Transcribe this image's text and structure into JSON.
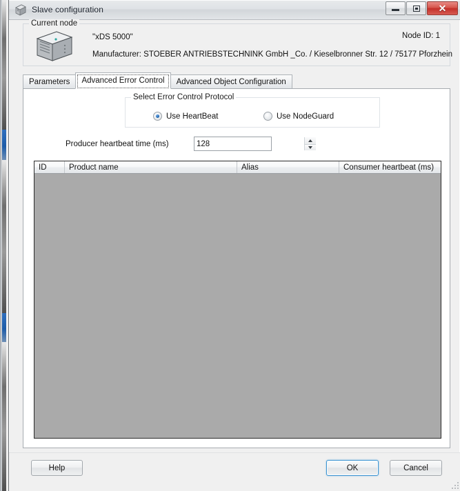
{
  "window": {
    "title": "Slave configuration",
    "icon": "device-box-icon",
    "controls": {
      "minimize_label": "Minimize",
      "restore_label": "Restore",
      "close_label": "Close",
      "close_glyph": "✕"
    }
  },
  "current_node": {
    "group_title": "Current node",
    "icon": "network-device-icon",
    "node_name": "\"xDS 5000\"",
    "node_id": "Node ID: 1",
    "manufacturer": "Manufacturer: STOEBER ANTRIEBSTECHNINK GmbH _Co. / Kieselbronner Str. 12 / 75177 Pforzhein"
  },
  "tabs": [
    {
      "label": "Parameters",
      "selected": false
    },
    {
      "label": "Advanced Error Control",
      "selected": true
    },
    {
      "label": "Advanced Object Configuration",
      "selected": false
    }
  ],
  "error_control": {
    "group_title": "Select Error Control Protocol",
    "options": [
      {
        "label": "Use HeartBeat",
        "checked": true
      },
      {
        "label": "Use NodeGuard",
        "checked": false
      }
    ],
    "heartbeat": {
      "label": "Producer heartbeat time (ms)",
      "value": "128",
      "placeholder": "",
      "spin_up": "▲",
      "spin_down": "▼"
    }
  },
  "grid": {
    "columns": [
      "ID",
      "Product name",
      "Alias",
      "Consumer heartbeat (ms)"
    ],
    "rows": [],
    "empty": true
  },
  "buttons": {
    "help": "Help",
    "ok": "OK",
    "cancel": "Cancel"
  },
  "colors": {
    "dialog_background": "#f0f0f0",
    "page_background": "#ffffff",
    "grid_empty_area": "#aaaaaa",
    "accent_focus": "#3c94d2",
    "radio_selected": "#1a5fa8",
    "close_button": "#c4302a"
  }
}
